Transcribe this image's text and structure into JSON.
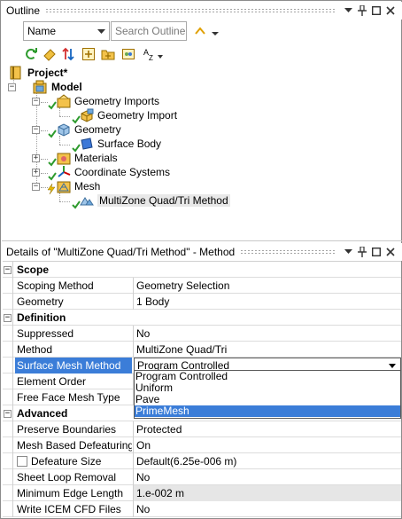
{
  "outline_panel": {
    "title": "Outline",
    "filter_combo_value": "Name",
    "search_placeholder": "Search Outline"
  },
  "tree": {
    "project_label": "Project*",
    "model_label": "Model",
    "geometry_imports_label": "Geometry Imports",
    "geometry_import_label": "Geometry Import",
    "geometry_label": "Geometry",
    "surface_body_label": "Surface Body",
    "materials_label": "Materials",
    "coordinate_systems_label": "Coordinate Systems",
    "mesh_label": "Mesh",
    "multizone_label": "MultiZone Quad/Tri Method"
  },
  "details_panel": {
    "title": "Details of \"MultiZone Quad/Tri Method\" - Method"
  },
  "details": {
    "scope_header": "Scope",
    "scoping_method_name": "Scoping Method",
    "scoping_method_value": "Geometry Selection",
    "geometry_name": "Geometry",
    "geometry_value": "1 Body",
    "definition_header": "Definition",
    "suppressed_name": "Suppressed",
    "suppressed_value": "No",
    "method_name": "Method",
    "method_value": "MultiZone Quad/Tri",
    "surface_mesh_method_name": "Surface Mesh Method",
    "surface_mesh_method_value": "Program Controlled",
    "element_order_name": "Element Order",
    "free_face_mesh_type_name": "Free Face Mesh Type",
    "advanced_header": "Advanced",
    "preserve_boundaries_name": "Preserve Boundaries",
    "preserve_boundaries_value": "Protected",
    "mesh_based_defeaturing_name": "Mesh Based Defeaturing",
    "mesh_based_defeaturing_value": "On",
    "defeature_size_name": "Defeature Size",
    "defeature_size_value": "Default(6.25e-006 m)",
    "sheet_loop_removal_name": "Sheet Loop Removal",
    "sheet_loop_removal_value": "No",
    "minimum_edge_length_name": "Minimum Edge Length",
    "minimum_edge_length_value": "1.e-002 m",
    "write_icem_name": "Write ICEM CFD Files",
    "write_icem_value": "No"
  },
  "dropdown_options": [
    "Program Controlled",
    "Uniform",
    "Pave",
    "PrimeMesh"
  ],
  "dropdown_active": "PrimeMesh",
  "colors": {
    "selection_blue": "#3b7dd8",
    "check_green": "#2e9b2e",
    "lightning_yellow": "#e6b800"
  }
}
